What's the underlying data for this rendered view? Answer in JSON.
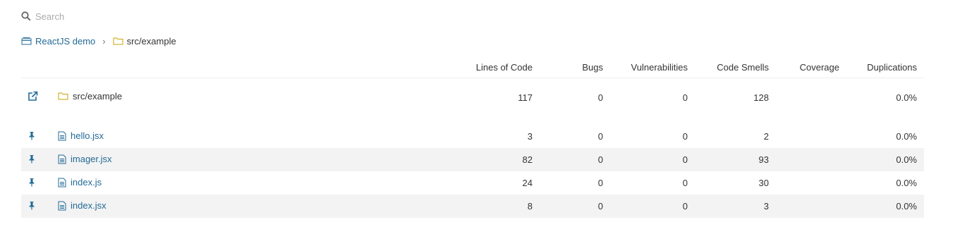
{
  "search": {
    "placeholder": "Search"
  },
  "breadcrumb": {
    "project": "ReactJS demo",
    "separator": "›",
    "current": "src/example"
  },
  "columns": [
    "Lines of Code",
    "Bugs",
    "Vulnerabilities",
    "Code Smells",
    "Coverage",
    "Duplications"
  ],
  "base": {
    "name": "src/example",
    "loc": "117",
    "bugs": "0",
    "vulnerabilities": "0",
    "code_smells": "128",
    "coverage": "",
    "duplications": "0.0%"
  },
  "files": [
    {
      "name": "hello.jsx",
      "loc": "3",
      "bugs": "0",
      "vulnerabilities": "0",
      "code_smells": "2",
      "coverage": "",
      "duplications": "0.0%"
    },
    {
      "name": "imager.jsx",
      "loc": "82",
      "bugs": "0",
      "vulnerabilities": "0",
      "code_smells": "93",
      "coverage": "",
      "duplications": "0.0%"
    },
    {
      "name": "index.js",
      "loc": "24",
      "bugs": "0",
      "vulnerabilities": "0",
      "code_smells": "30",
      "coverage": "",
      "duplications": "0.0%"
    },
    {
      "name": "index.jsx",
      "loc": "8",
      "bugs": "0",
      "vulnerabilities": "0",
      "code_smells": "3",
      "coverage": "",
      "duplications": "0.0%"
    }
  ],
  "colors": {
    "link": "#236a97",
    "folder": "#c7a500",
    "row_alt": "#f3f3f3",
    "placeholder": "#aaaaaa"
  },
  "icons": {
    "search": "search-icon",
    "project": "project-icon",
    "folder": "folder-icon",
    "file": "file-icon",
    "pin": "pin-icon",
    "open": "open-external-icon"
  }
}
